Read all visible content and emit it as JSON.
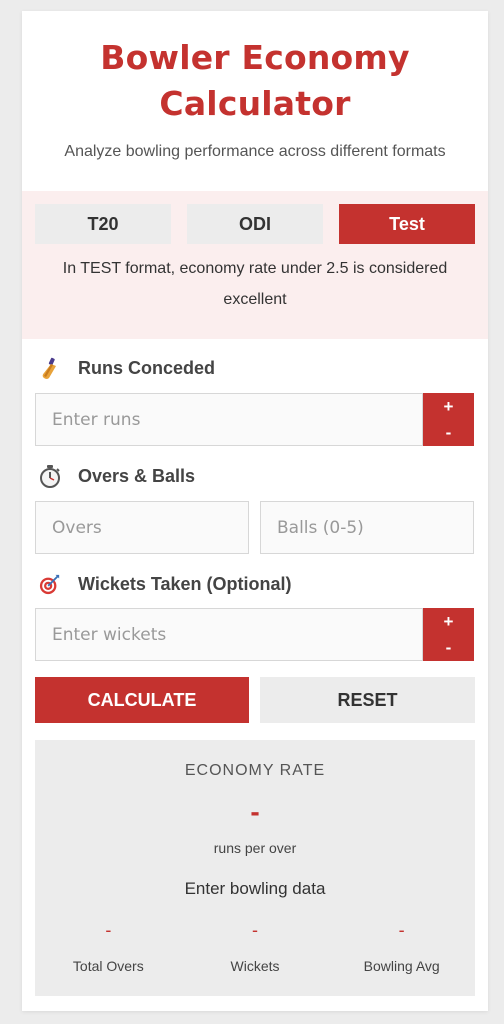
{
  "header": {
    "title_line1": "Bowler Economy",
    "title_line2": "Calculator",
    "subtitle": "Analyze bowling performance across different formats"
  },
  "formats": {
    "tabs": [
      {
        "label": "T20",
        "active": false
      },
      {
        "label": "ODI",
        "active": false
      },
      {
        "label": "Test",
        "active": true
      }
    ],
    "note": "In TEST format, economy rate under 2.5 is considered excellent"
  },
  "runs": {
    "label": "Runs Conceded",
    "icon": "cricket-bat-icon",
    "placeholder": "Enter runs",
    "plus": "+",
    "minus": "-"
  },
  "overs": {
    "label": "Overs & Balls",
    "icon": "stopwatch-icon",
    "overs_placeholder": "Overs",
    "balls_placeholder": "Balls (0-5)"
  },
  "wickets": {
    "label": "Wickets Taken (Optional)",
    "icon": "target-icon",
    "placeholder": "Enter wickets",
    "plus": "+",
    "minus": "-"
  },
  "actions": {
    "calculate": "CALCULATE",
    "reset": "RESET"
  },
  "results": {
    "title": "ECONOMY RATE",
    "value": "-",
    "unit": "runs per over",
    "message": "Enter bowling data",
    "stats": [
      {
        "value": "-",
        "label": "Total Overs"
      },
      {
        "value": "-",
        "label": "Wickets"
      },
      {
        "value": "-",
        "label": "Bowling Avg"
      }
    ]
  },
  "colors": {
    "accent": "#c4322f",
    "format_bg": "#fbeeee",
    "panel_bg": "#ececec"
  }
}
